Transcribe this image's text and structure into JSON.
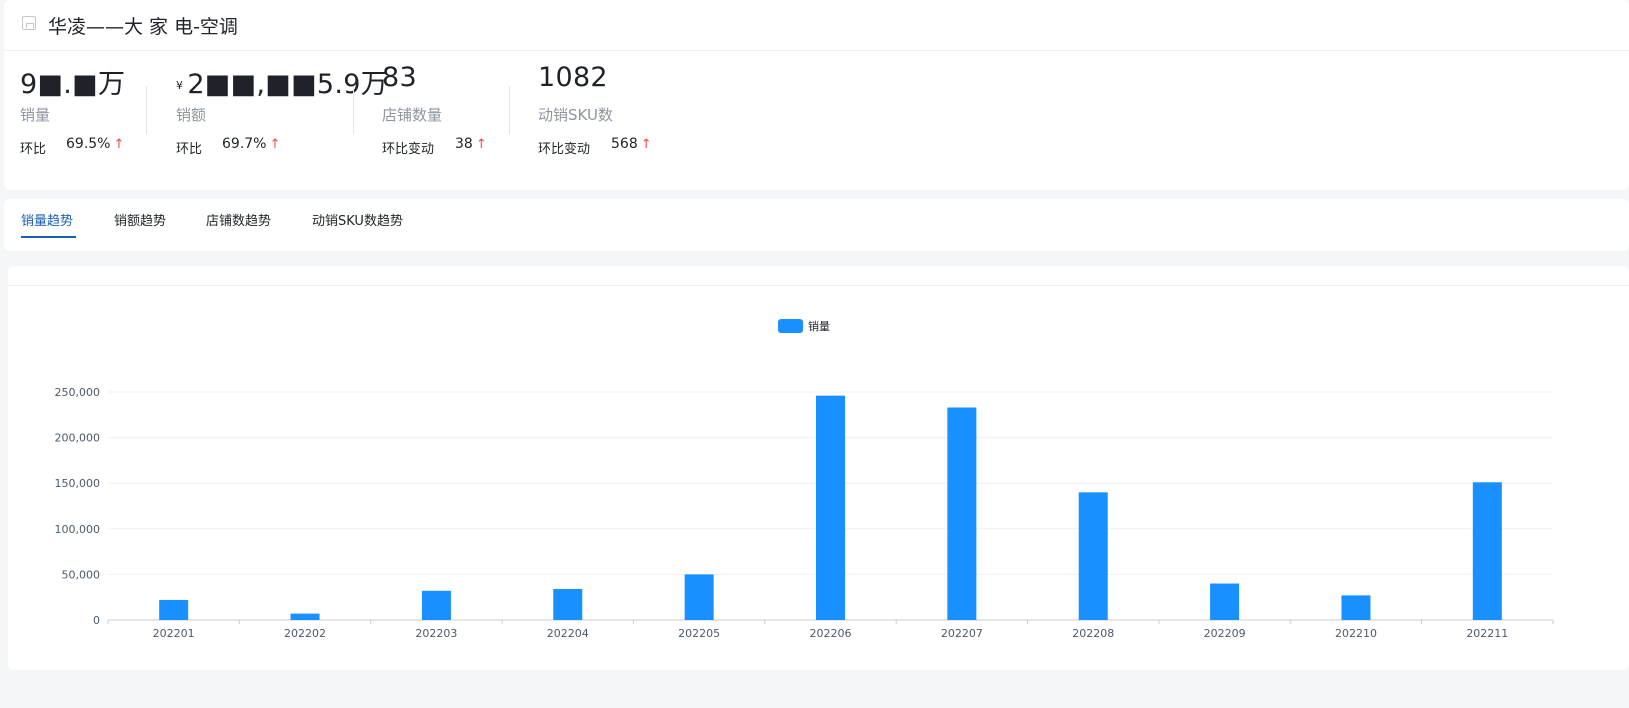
{
  "header": {
    "title": "华凌——大 家 电-空调"
  },
  "stats": [
    {
      "value": "9■.■万",
      "prefix": "",
      "label": "销量",
      "change_label": "环比",
      "change_value": "69.5%"
    },
    {
      "value": "2■■,■■5.9万",
      "prefix": "¥",
      "label": "销额",
      "change_label": "环比",
      "change_value": "69.7%"
    },
    {
      "value": "83",
      "prefix": "",
      "label": "店铺数量",
      "change_label": "环比变动",
      "change_value": "38"
    },
    {
      "value": "1082",
      "prefix": "",
      "label": "动销SKU数",
      "change_label": "环比变动",
      "change_value": "568"
    }
  ],
  "arrow_symbol": "↑",
  "tabs": [
    {
      "label": "销量趋势",
      "active": true
    },
    {
      "label": "销额趋势",
      "active": false
    },
    {
      "label": "店铺数趋势",
      "active": false
    },
    {
      "label": "动销SKU数趋势",
      "active": false
    }
  ],
  "colors": {
    "accent": "#1a5fb4",
    "bar": "#1890ff",
    "up": "#f04b4b"
  },
  "chart_data": {
    "type": "bar",
    "legend": [
      "销量"
    ],
    "categories": [
      "202201",
      "202202",
      "202203",
      "202204",
      "202205",
      "202206",
      "202207",
      "202208",
      "202209",
      "202210",
      "202211"
    ],
    "series": [
      {
        "name": "销量",
        "values": [
          22000,
          7000,
          32000,
          34000,
          50000,
          246000,
          233000,
          140000,
          40000,
          27000,
          151000
        ]
      }
    ],
    "yticks": [
      "0",
      "50,000",
      "100,000",
      "150,000",
      "200,000",
      "250,000"
    ],
    "ylim": [
      0,
      250000
    ],
    "grid": true,
    "legend_position": "top-center"
  }
}
